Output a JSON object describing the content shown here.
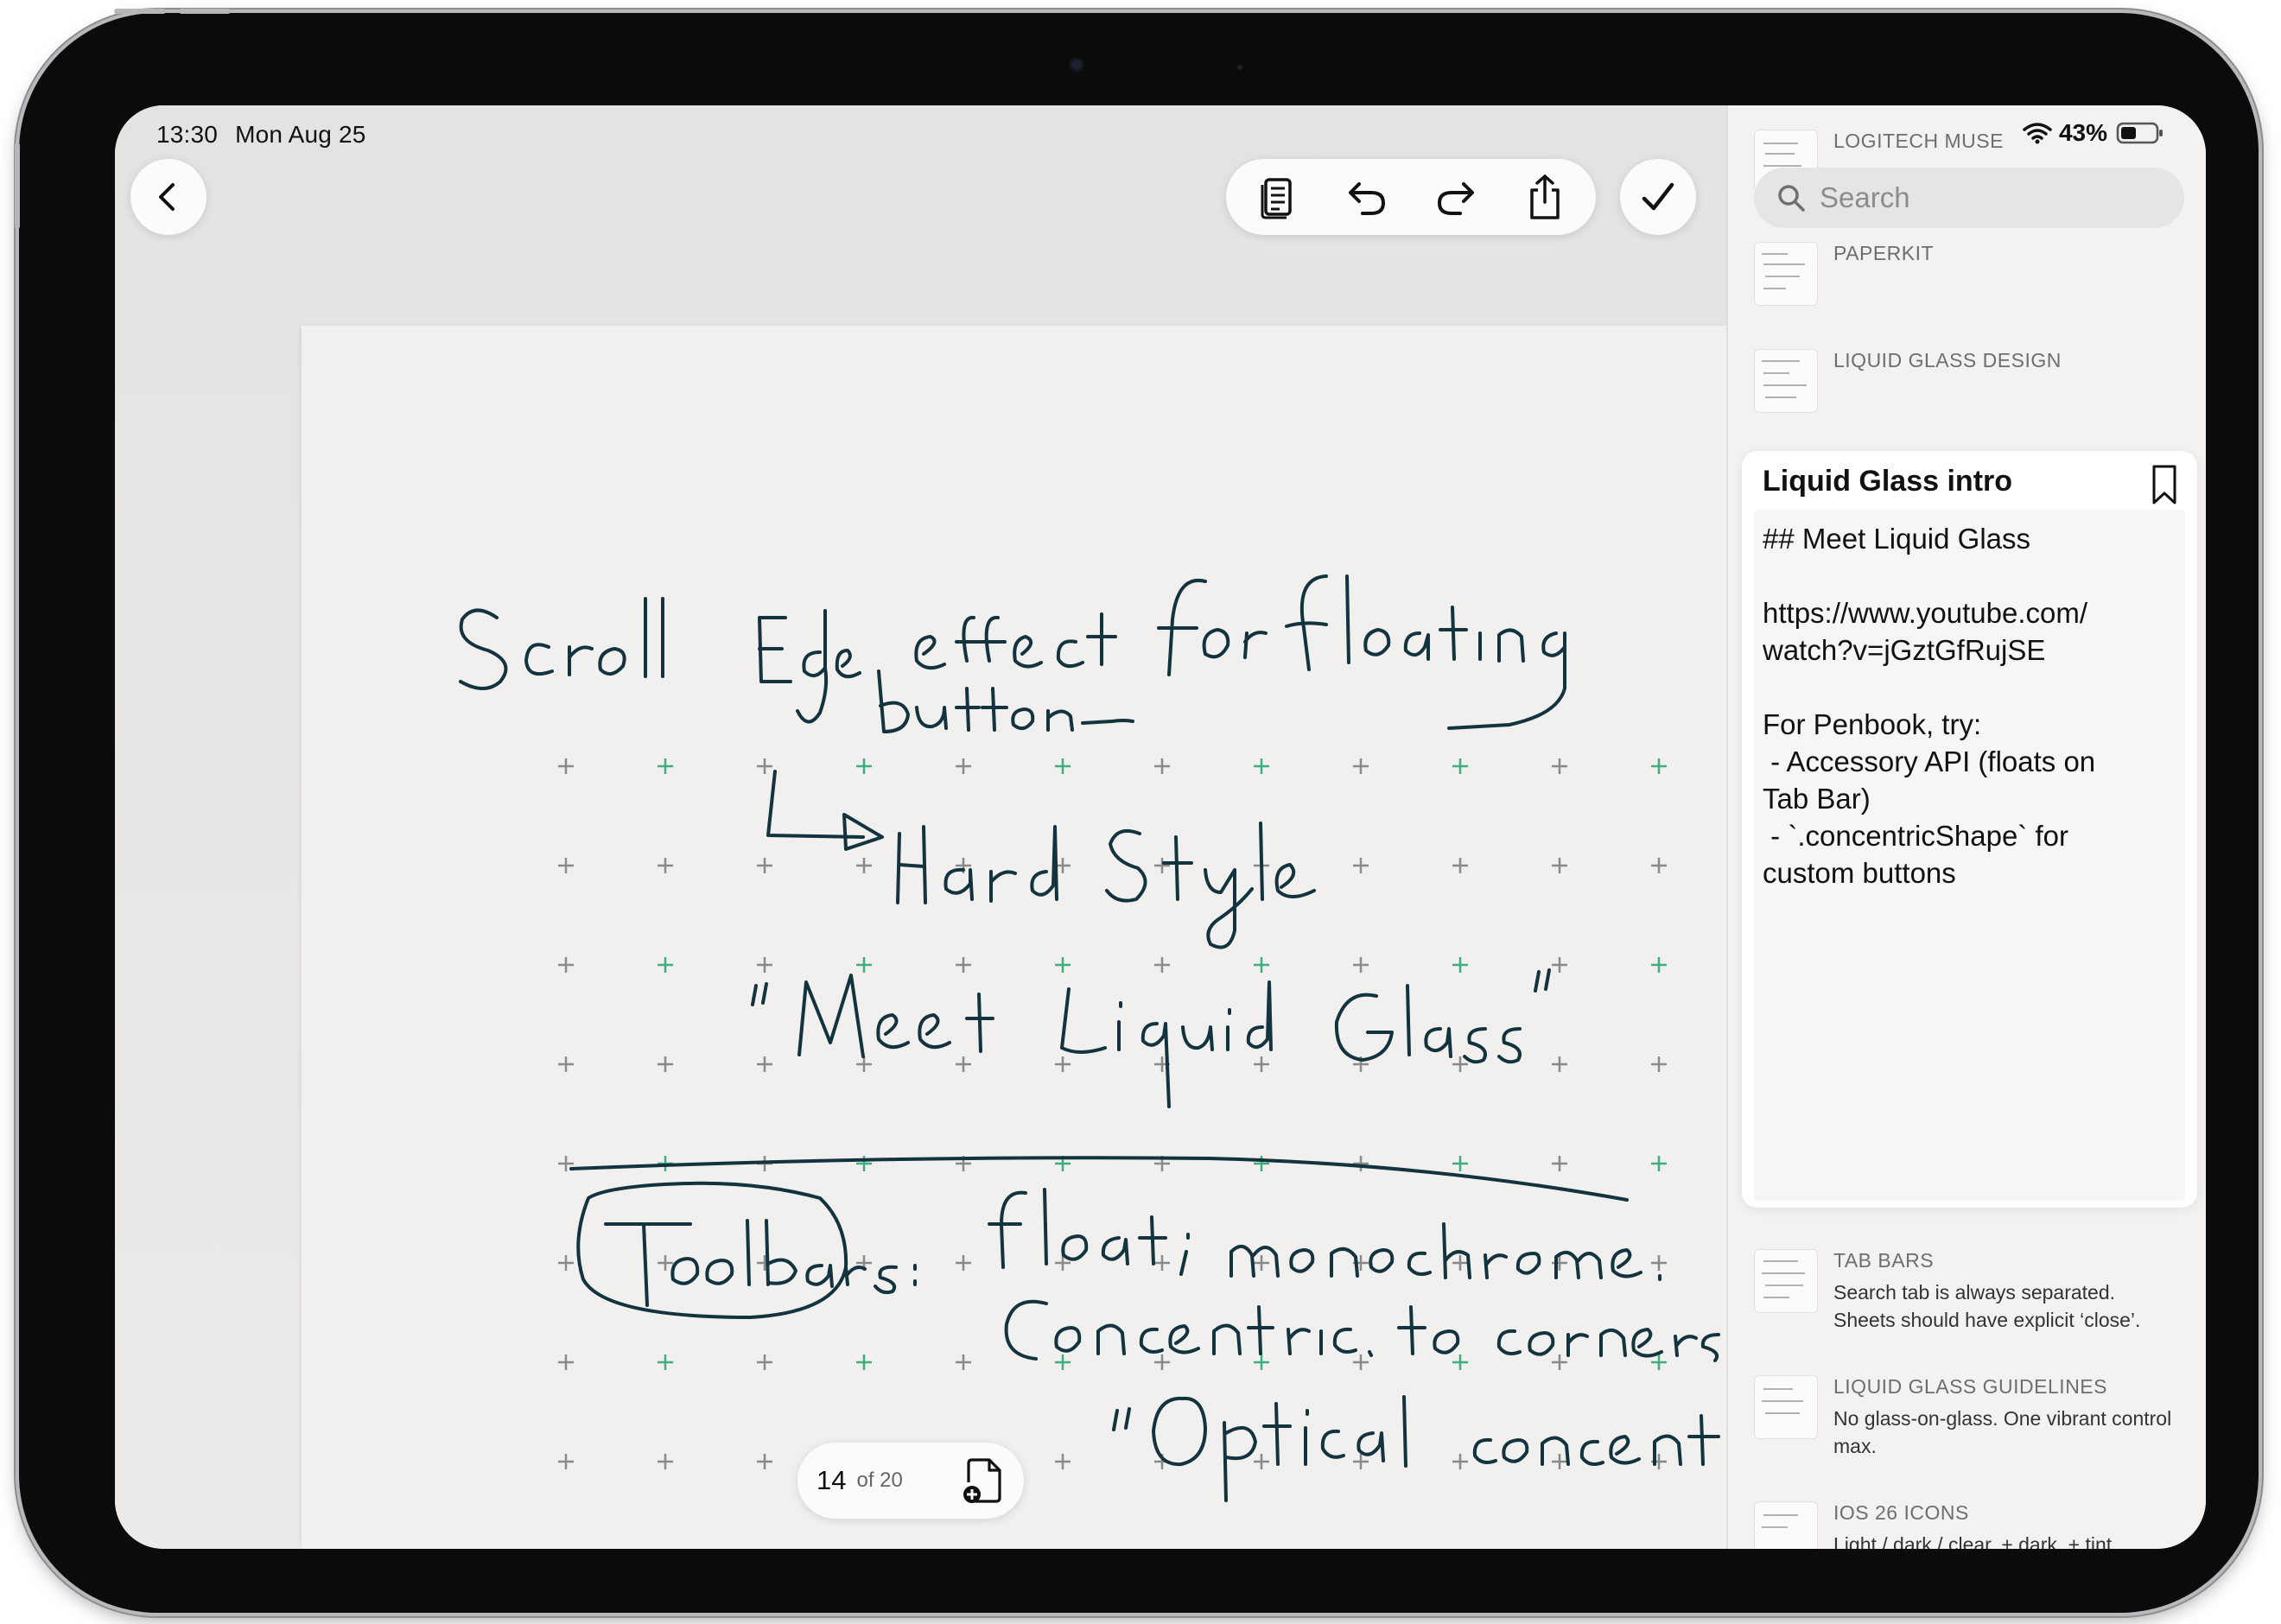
{
  "status": {
    "time": "13:30",
    "date": "Mon Aug 25",
    "battery": "43%"
  },
  "toolbar": {
    "back_icon": "chevron-left-icon",
    "items": [
      "page-icon",
      "undo-icon",
      "redo-icon",
      "share-icon"
    ],
    "done_icon": "checkmark-icon"
  },
  "pager": {
    "current": "14",
    "total_label": "of 20",
    "add_icon": "add-page-icon"
  },
  "handwriting": {
    "lines": [
      "Scroll Edge effect for floating buttons",
      "↳ Hard Style",
      "\"Meet Liquid Glass\"",
      "Toolbars:",
      "float; monochrome.",
      "Concentric to corners of device",
      "\"Optical concentricity\""
    ]
  },
  "sidebar": {
    "search_placeholder": "Search",
    "notes_top": [
      {
        "title": "LOGITECH MUSE"
      },
      {
        "title": "PAPERKIT"
      },
      {
        "title": "LIQUID GLASS DESIGN"
      }
    ],
    "selected": {
      "title": "Liquid Glass intro",
      "body": "## Meet Liquid Glass\n\nhttps://www.youtube.com/\nwatch?v=jGztGfRujSE\n\nFor Penbook, try:\n - Accessory API (floats on\nTab Bar)\n - `.concentricShape` for\ncustom buttons"
    },
    "notes_bottom": [
      {
        "title": "TAB BARS",
        "subtitle": "Search tab is always separated. Sheets should have explicit ‘close’."
      },
      {
        "title": "LIQUID GLASS GUIDELINES",
        "subtitle": "No glass-on-glass. One vibrant control max."
      },
      {
        "title": "IOS 26 ICONS",
        "subtitle": "Light / dark / clear. + dark. + tint"
      }
    ]
  },
  "colors": {
    "ink": "#13333f",
    "grid_gray": "#8a8a8a",
    "grid_green": "#3fae7f",
    "paper": "#f1f0ee"
  }
}
